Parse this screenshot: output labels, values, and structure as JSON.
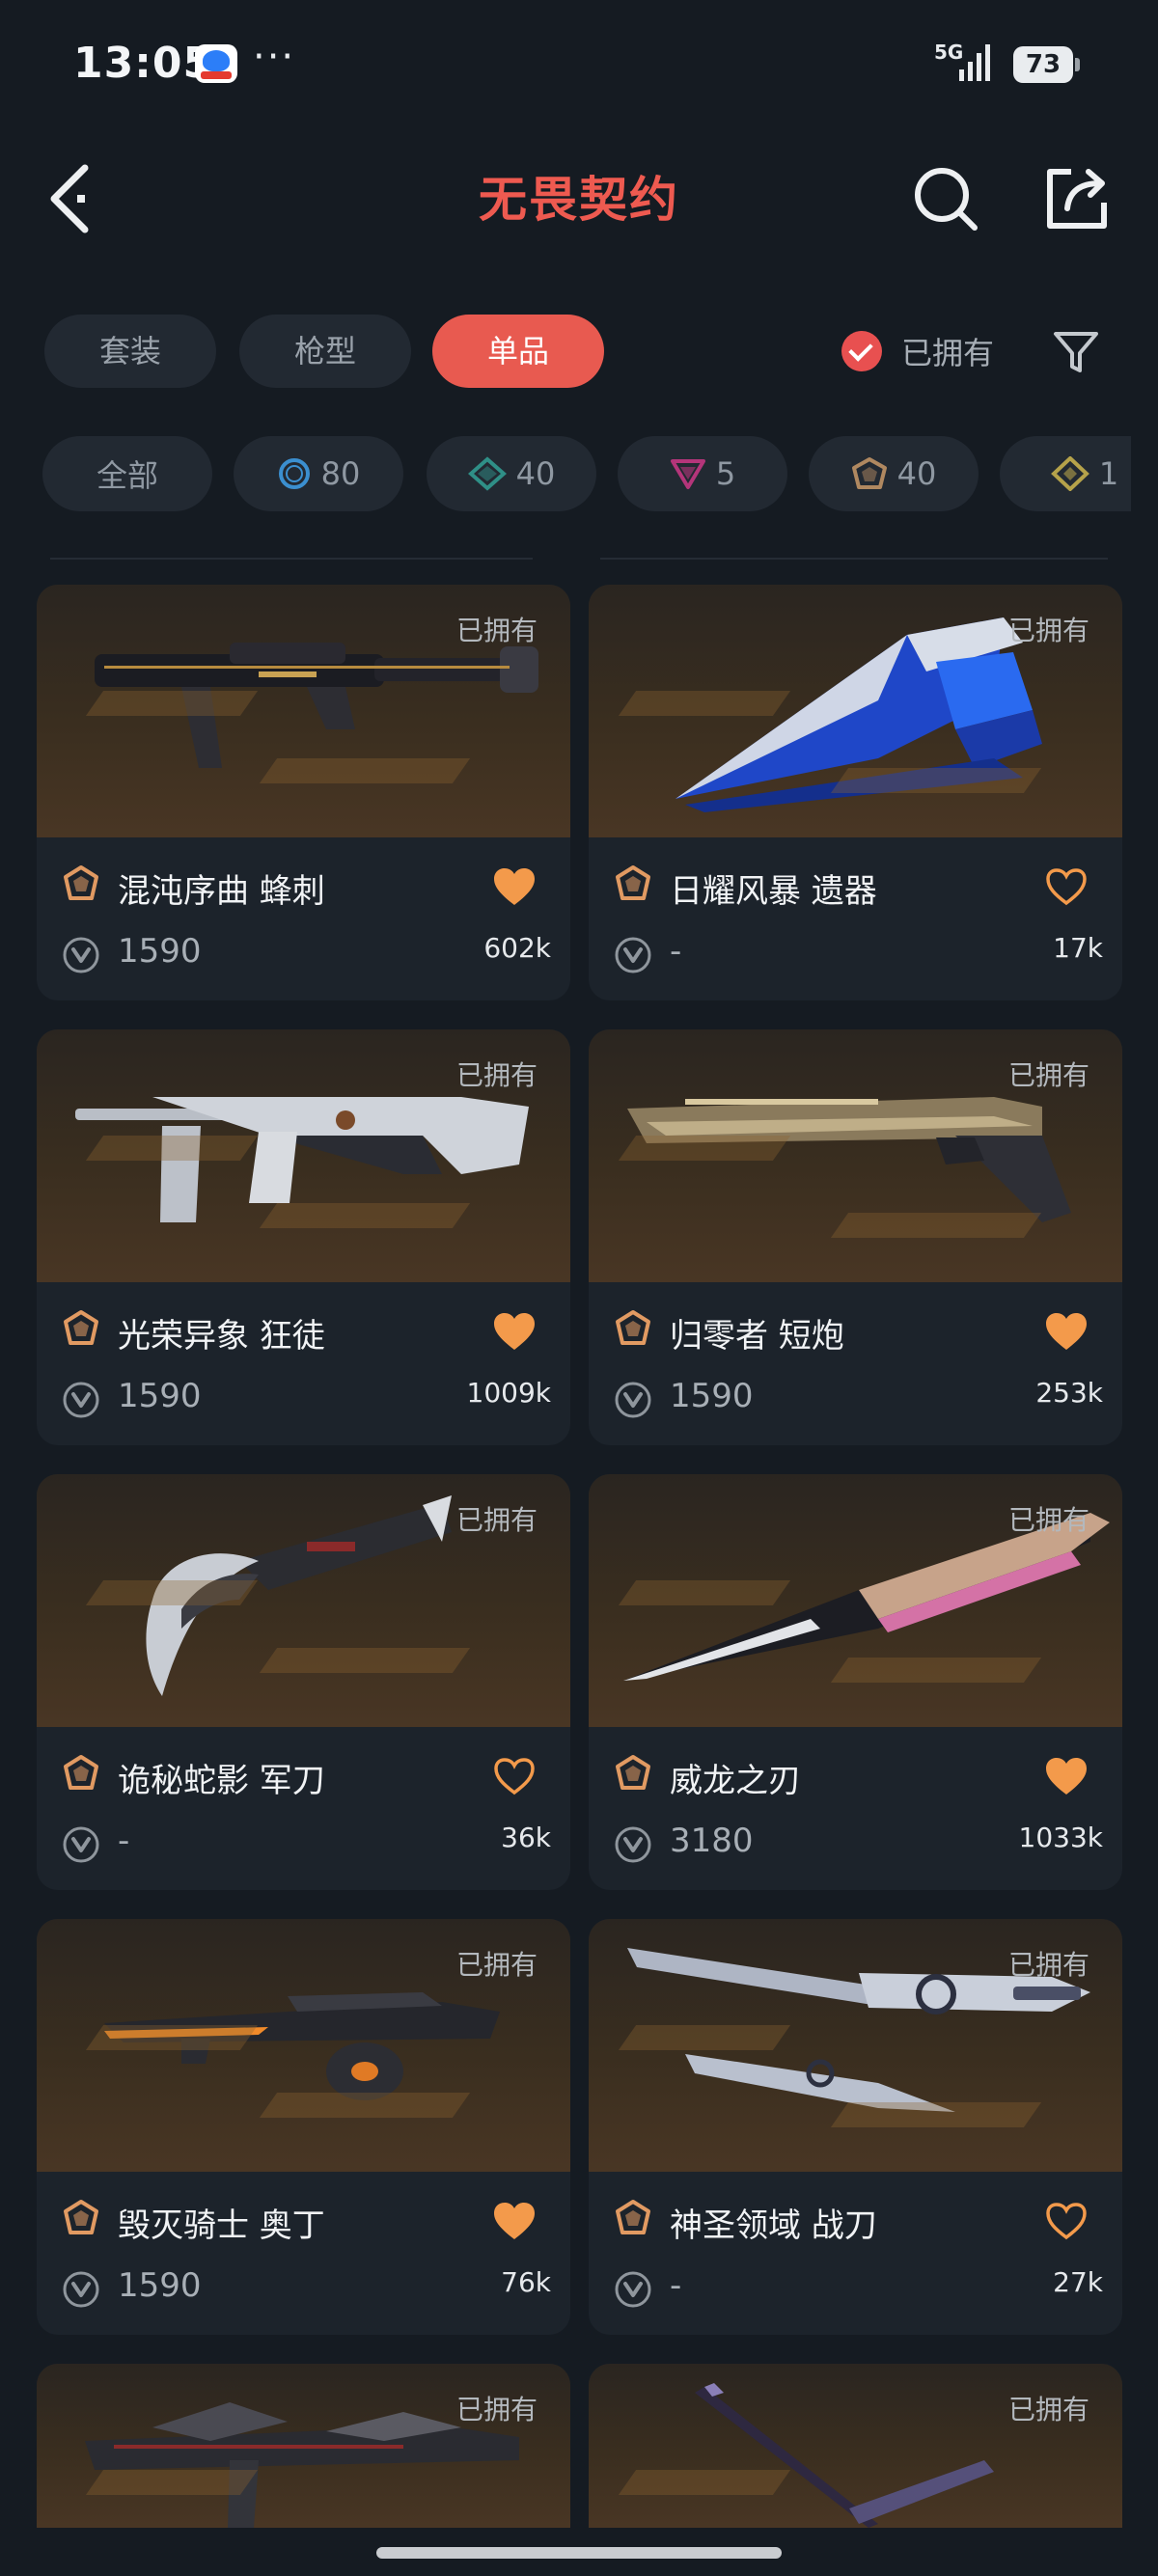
{
  "status_bar": {
    "time": "13:05",
    "dots": "···",
    "network": "5G",
    "battery": "73"
  },
  "header": {
    "title": "无畏契约"
  },
  "tabs": [
    {
      "label": "套装",
      "active": false
    },
    {
      "label": "枪型",
      "active": false
    },
    {
      "label": "单品",
      "active": true
    }
  ],
  "owned_filter": {
    "label": "已拥有",
    "checked": true
  },
  "rarity_chips": [
    {
      "label": "全部",
      "icon": "none"
    },
    {
      "label": "80",
      "icon": "select-tier-icon",
      "color": "#3b8fd0"
    },
    {
      "label": "40",
      "icon": "deluxe-tier-icon",
      "color": "#2f8f87"
    },
    {
      "label": "5",
      "icon": "premium-tier-icon",
      "color": "#b4357a"
    },
    {
      "label": "40",
      "icon": "exclusive-tier-icon",
      "color": "#b08860"
    },
    {
      "label": "1",
      "icon": "ultra-tier-icon",
      "color": "#b5a24a"
    }
  ],
  "cards": [
    {
      "name": "混沌序曲 蜂刺",
      "price": "1590",
      "likes": "602k",
      "owned": "已拥有",
      "liked": true,
      "weapon": "smg"
    },
    {
      "name": "日耀风暴 遗器",
      "price": "-",
      "likes": "17k",
      "owned": "已拥有",
      "liked": false,
      "weapon": "crystal-blade"
    },
    {
      "name": "光荣异象 狂徒",
      "price": "1590",
      "likes": "1009k",
      "owned": "已拥有",
      "liked": true,
      "weapon": "rifle"
    },
    {
      "name": "归零者 短炮",
      "price": "1590",
      "likes": "253k",
      "owned": "已拥有",
      "liked": true,
      "weapon": "shorty"
    },
    {
      "name": "诡秘蛇影 军刀",
      "price": "-",
      "likes": "36k",
      "owned": "已拥有",
      "liked": false,
      "weapon": "karambit"
    },
    {
      "name": "威龙之刃",
      "price": "3180",
      "likes": "1033k",
      "owned": "已拥有",
      "liked": true,
      "weapon": "dagger"
    },
    {
      "name": "毁灭骑士 奥丁",
      "price": "1590",
      "likes": "76k",
      "owned": "已拥有",
      "liked": true,
      "weapon": "odin"
    },
    {
      "name": "神圣领域 战刀",
      "price": "-",
      "likes": "27k",
      "owned": "已拥有",
      "liked": false,
      "weapon": "swords"
    },
    {
      "name": "",
      "price": "",
      "likes": "",
      "owned": "已拥有",
      "liked": false,
      "weapon": "partial-rifle"
    },
    {
      "name": "",
      "price": "",
      "likes": "",
      "owned": "已拥有",
      "liked": false,
      "weapon": "partial-katana"
    }
  ],
  "colors": {
    "accent": "#e85a50",
    "heart": "#f39a4b",
    "background": "#151b22",
    "card": "#1c232b"
  }
}
